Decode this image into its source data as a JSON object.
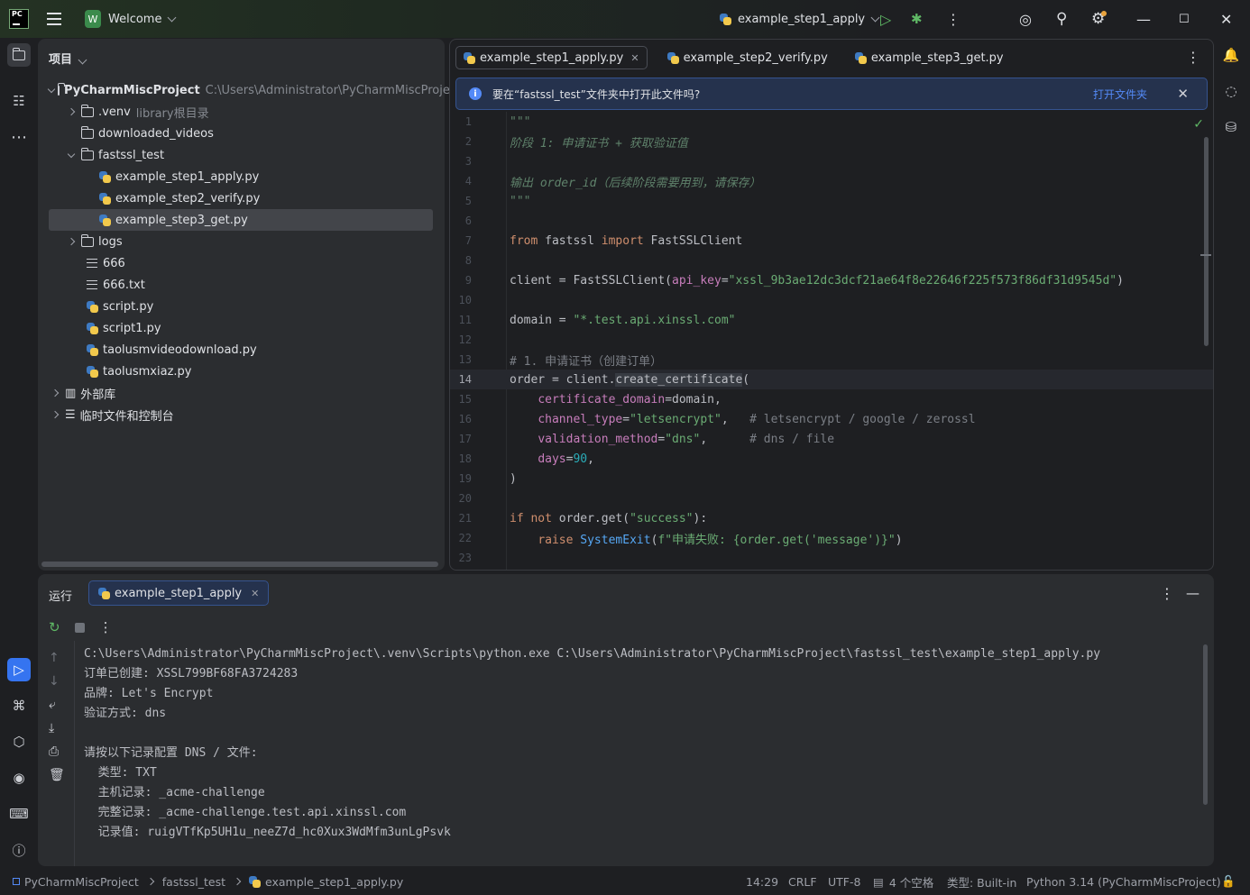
{
  "titlebar": {
    "app_logo": "PC",
    "project_chip": "W",
    "project_name": "Welcome",
    "run_config": "example_step1_apply"
  },
  "project_panel": {
    "title": "项目",
    "tree": [
      {
        "label": "PyCharmMiscProject",
        "hint": "C:\\Users\\Administrator\\PyCharmMiscProject",
        "icon": "project-folder-icon"
      },
      {
        "label": ".venv",
        "hint": "library根目录",
        "icon": "folder-icon"
      },
      {
        "label": "downloaded_videos",
        "icon": "folder-icon"
      },
      {
        "label": "fastssl_test",
        "icon": "folder-icon"
      },
      {
        "label": "example_step1_apply.py",
        "icon": "python-file-icon"
      },
      {
        "label": "example_step2_verify.py",
        "icon": "python-file-icon"
      },
      {
        "label": "example_step3_get.py",
        "icon": "python-file-icon"
      },
      {
        "label": "logs",
        "icon": "folder-icon"
      },
      {
        "label": "666",
        "icon": "text-file-icon"
      },
      {
        "label": "666.txt",
        "icon": "text-file-icon"
      },
      {
        "label": "script.py",
        "icon": "python-file-icon"
      },
      {
        "label": "script1.py",
        "icon": "python-file-icon"
      },
      {
        "label": "taolusmvideodownload.py",
        "icon": "python-file-icon"
      },
      {
        "label": "taolusmxiaz.py",
        "icon": "python-file-icon"
      },
      {
        "label": "外部库",
        "icon": "library-icon"
      },
      {
        "label": "临时文件和控制台",
        "icon": "scratches-icon"
      }
    ]
  },
  "editor": {
    "tabs": [
      {
        "label": "example_step1_apply.py",
        "active": true
      },
      {
        "label": "example_step2_verify.py",
        "active": false
      },
      {
        "label": "example_step3_get.py",
        "active": false
      }
    ],
    "banner": {
      "message": "要在“fastssl_test”文件夹中打开此文件吗?",
      "link": "打开文件夹"
    },
    "current_line": 14,
    "lines": [
      "\"\"\"",
      "阶段 1: 申请证书 + 获取验证值",
      "",
      "输出 order_id（后续阶段需要用到，请保存）",
      "\"\"\"",
      "",
      "from fastssl import FastSSLClient",
      "",
      "client = FastSSLClient(api_key=\"xssl_9b3ae12dc3dcf21ae64f8e22646f225f573f86df31d9545d\")",
      "",
      "domain = \"*.test.api.xinssl.com\"",
      "",
      "# 1. 申请证书（创建订单）",
      "order = client.create_certificate(",
      "    certificate_domain=domain,",
      "    channel_type=\"letsencrypt\",   # letsencrypt / google / zerossl",
      "    validation_method=\"dns\",      # dns / file",
      "    days=90,",
      ")",
      "",
      "if not order.get(\"success\"):",
      "    raise SystemExit(f\"申请失败: {order.get('message')}\")",
      ""
    ]
  },
  "run_panel": {
    "title": "运行",
    "tab": "example_step1_apply",
    "console": [
      "C:\\Users\\Administrator\\PyCharmMiscProject\\.venv\\Scripts\\python.exe C:\\Users\\Administrator\\PyCharmMiscProject\\fastssl_test\\example_step1_apply.py",
      "订单已创建: XSSL799BF68FA3724283",
      "品牌: Let's Encrypt",
      "验证方式: dns",
      "",
      "请按以下记录配置 DNS / 文件:",
      "  类型: TXT",
      "  主机记录: _acme-challenge",
      "  完整记录: _acme-challenge.test.api.xinssl.com",
      "  记录值: ruigVTfKp5UH1u_neeZ7d_hc0Xux3WdMfm3unLgPsvk"
    ]
  },
  "statusbar": {
    "breadcrumb": [
      "PyCharmMiscProject",
      "fastssl_test",
      "example_step1_apply.py"
    ],
    "position": "14:29",
    "line_ending": "CRLF",
    "encoding": "UTF-8",
    "indent": "4 个空格",
    "file_type": "类型: Built-in",
    "interpreter": "Python 3.14 (PyCharmMiscProject)"
  },
  "colors": {
    "accent": "#548af7",
    "background": "#1e1f22",
    "panel": "#2b2d30"
  }
}
